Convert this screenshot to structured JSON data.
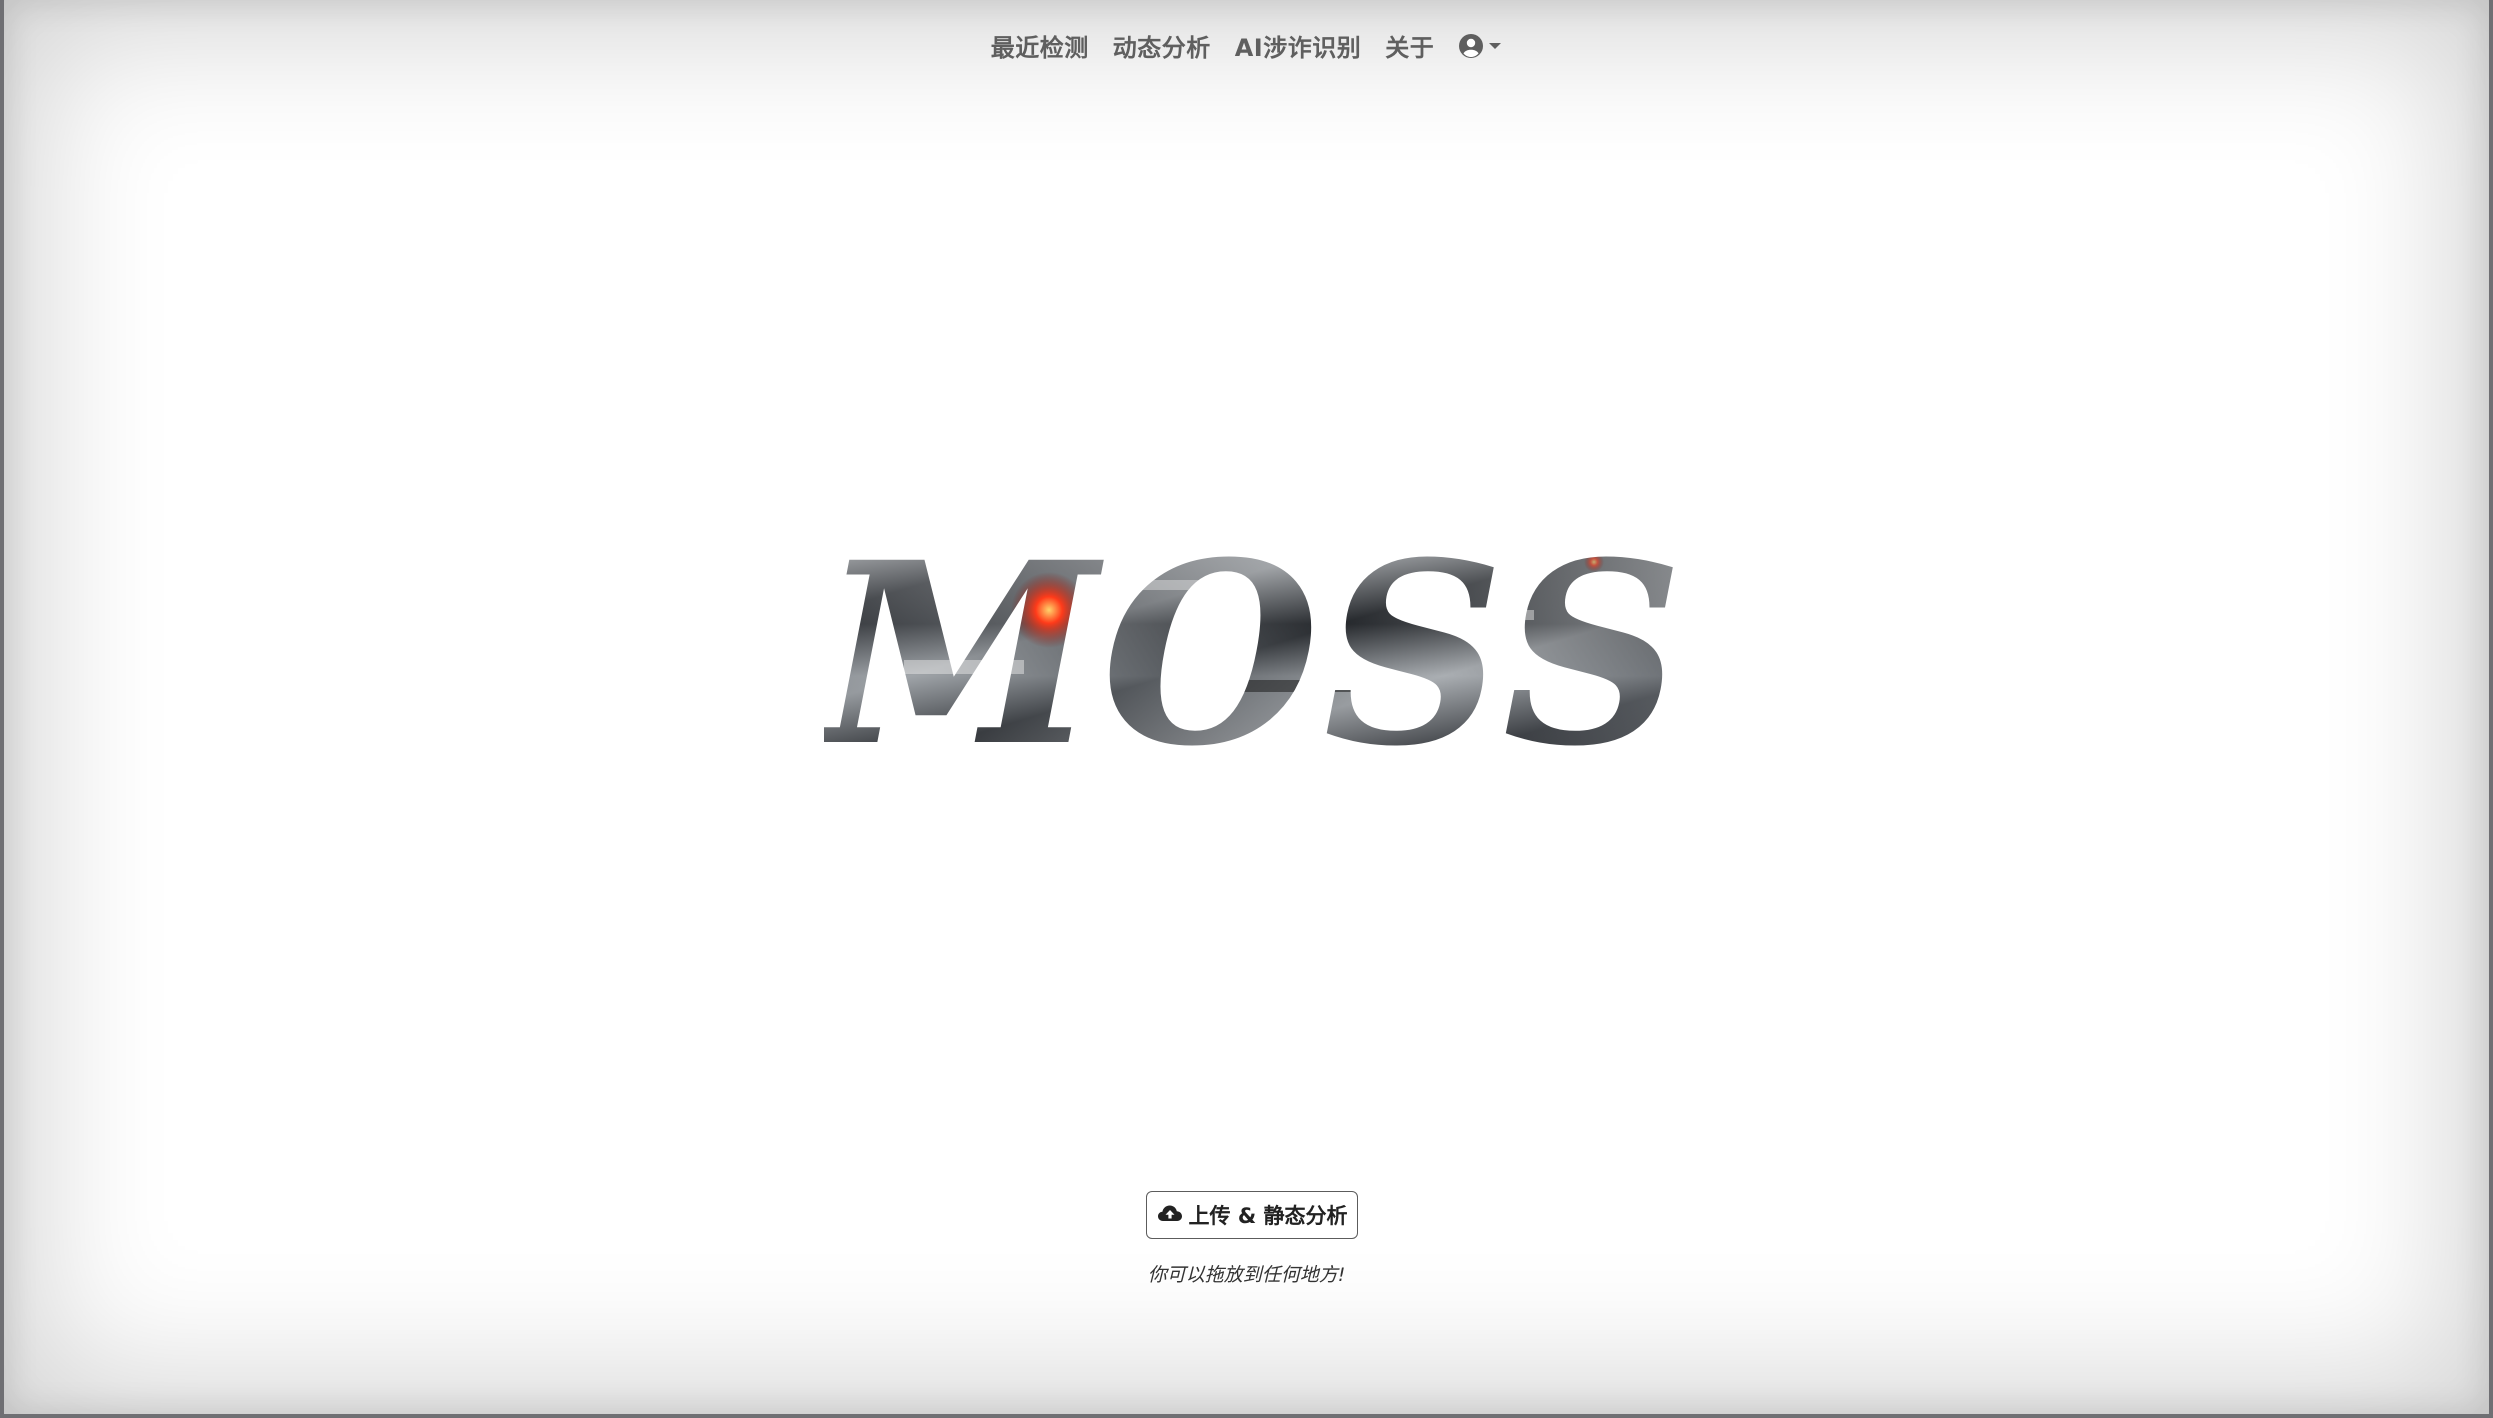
{
  "nav": {
    "items": [
      {
        "label": "最近检测"
      },
      {
        "label": "动态分析"
      },
      {
        "label": "AI涉诈识别"
      },
      {
        "label": "关于"
      }
    ],
    "user_icon": "user-circle-icon",
    "caret_icon": "caret-down-icon"
  },
  "logo": {
    "text": "MOSS"
  },
  "upload": {
    "icon": "cloud-upload-icon",
    "label": "上传 & 静态分析"
  },
  "hint": {
    "text": "你可以拖放到任何地方!"
  },
  "colors": {
    "nav_text": "#5f5f5f",
    "logo_accent": "#e33b1f",
    "logo_metal": "#2b2e33"
  }
}
